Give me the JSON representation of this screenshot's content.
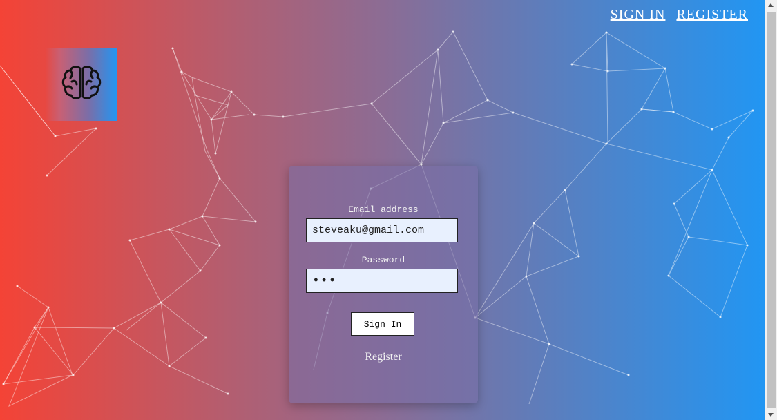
{
  "nav": {
    "sign_in": "SIGN IN",
    "register": "REGISTER"
  },
  "logo": {
    "icon": "brain-icon"
  },
  "form": {
    "email_label": "Email address",
    "email_value": "steveaku@gmail.com",
    "password_label": "Password",
    "password_value": "•••",
    "sign_in_button": "Sign In",
    "register_link": "Register"
  },
  "colors": {
    "gradient_left": "#f44336",
    "gradient_right": "#2196f3",
    "input_bg": "#e8f0fe"
  }
}
